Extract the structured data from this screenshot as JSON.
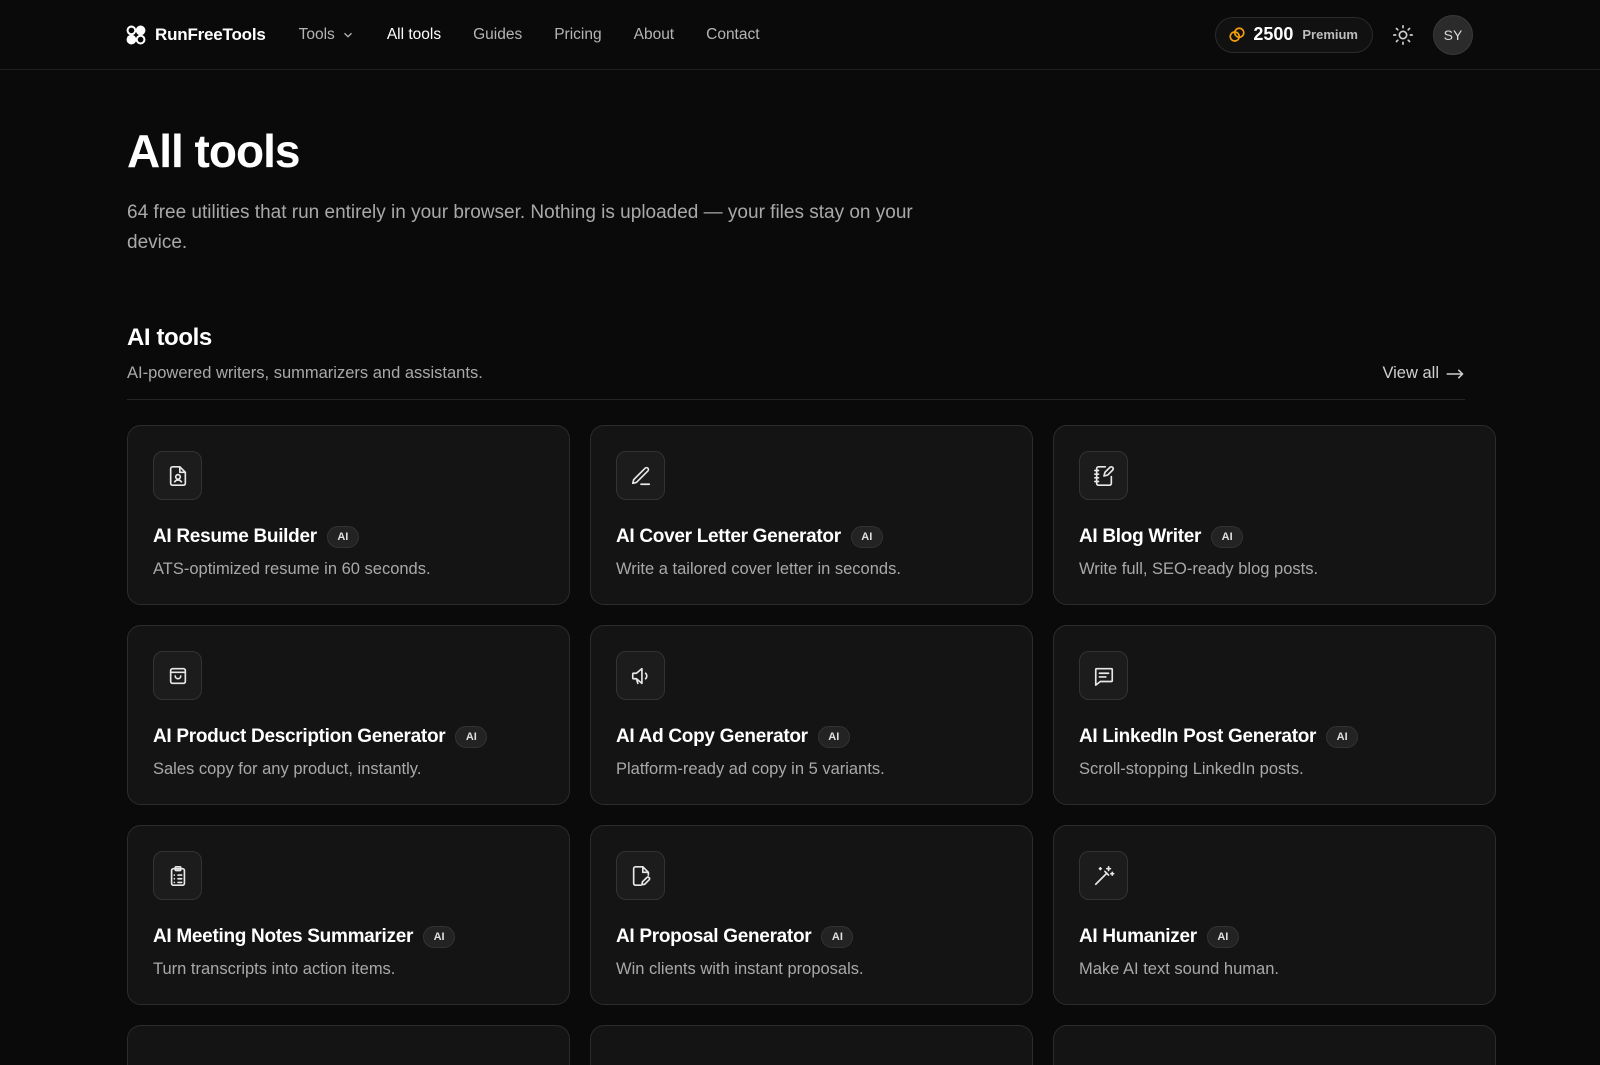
{
  "header": {
    "brand": "RunFreeTools",
    "nav": [
      {
        "label": "Tools",
        "dropdown": true,
        "active": false
      },
      {
        "label": "All tools",
        "active": true
      },
      {
        "label": "Guides",
        "active": false
      },
      {
        "label": "Pricing",
        "active": false
      },
      {
        "label": "About",
        "active": false
      },
      {
        "label": "Contact",
        "active": false
      }
    ],
    "credits": {
      "amount": "2500",
      "plan": "Premium",
      "icon": "coins-icon",
      "accent": "#f59e0b"
    },
    "theme_icon": "sun-icon",
    "avatar_initials": "SY"
  },
  "page": {
    "title": "All tools",
    "lead": "64 free utilities that run entirely in your browser. Nothing is uploaded — your files stay on your device."
  },
  "section": {
    "title": "AI tools",
    "subtitle": "AI-powered writers, summarizers and assistants.",
    "view_all": "View all",
    "cards": [
      {
        "icon": "file-user-icon",
        "title": "AI Resume Builder",
        "badge": "AI",
        "desc": "ATS-optimized resume in 60 seconds."
      },
      {
        "icon": "pen-icon",
        "title": "AI Cover Letter Generator",
        "badge": "AI",
        "desc": "Write a tailored cover letter in seconds."
      },
      {
        "icon": "notebook-pen-icon",
        "title": "AI Blog Writer",
        "badge": "AI",
        "desc": "Write full, SEO-ready blog posts."
      },
      {
        "icon": "shopping-bag-icon",
        "title": "AI Product Description Generator",
        "badge": "AI",
        "desc": "Sales copy for any product, instantly."
      },
      {
        "icon": "megaphone-icon",
        "title": "AI Ad Copy Generator",
        "badge": "AI",
        "desc": "Platform-ready ad copy in 5 variants."
      },
      {
        "icon": "message-square-text-icon",
        "title": "AI LinkedIn Post Generator",
        "badge": "AI",
        "desc": "Scroll-stopping LinkedIn posts."
      },
      {
        "icon": "clipboard-list-icon",
        "title": "AI Meeting Notes Summarizer",
        "badge": "AI",
        "desc": "Turn transcripts into action items."
      },
      {
        "icon": "file-pen-icon",
        "title": "AI Proposal Generator",
        "badge": "AI",
        "desc": "Win clients with instant proposals."
      },
      {
        "icon": "wand-sparkles-icon",
        "title": "AI Humanizer",
        "badge": "AI",
        "desc": "Make AI text sound human."
      }
    ]
  }
}
